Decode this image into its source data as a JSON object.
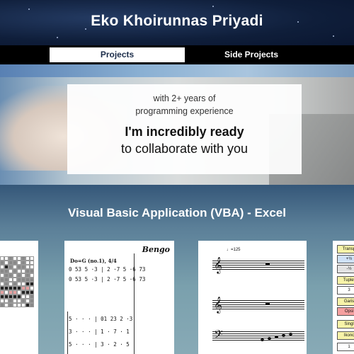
{
  "header": {
    "title": "Eko Khoirunnas Priyadi"
  },
  "nav": {
    "tabs": [
      {
        "label": "Projects",
        "active": true
      },
      {
        "label": "Side Projects",
        "active": false
      }
    ]
  },
  "hero": {
    "line1": "with 2+ years of",
    "line2": "programming experience",
    "line3": "I'm incredibly ready",
    "line4": "to collaborate with you"
  },
  "section": {
    "title": "Visual Basic Application (VBA) - Excel"
  },
  "thumbnails": [
    {
      "name": "VBA grid puzzle sheet"
    },
    {
      "name": "VBA numbered notation sheet",
      "heading": "Bengo",
      "key": "Do=G (no.1), 4/4",
      "row1": "0 53 5 ·3 | 2 ·7 5 ·6 73",
      "row2": "0 53 5 ·3 | 2 ·7 5 ·6 73",
      "row3": "5 · · · | 01 23 2 ·3",
      "row4": "3 · · · | 1 · 7 · 1",
      "row5": "5 · · · | 3 · 2 · 5"
    },
    {
      "name": "VBA staff notation sheet",
      "tempo": "♩=125"
    },
    {
      "name": "VBA transpose tool",
      "labels": [
        "Transp",
        "+½",
        "-½",
        "Tuplet",
        "3",
        "Garis",
        "Opsi",
        "Singl",
        "Ikonc",
        "1"
      ]
    }
  ],
  "colors": {
    "header_bg": "#0f1e3a",
    "nav_bg": "#000000",
    "active_tab_bg": "#ffffff",
    "section_bg": "#5b7f98"
  }
}
